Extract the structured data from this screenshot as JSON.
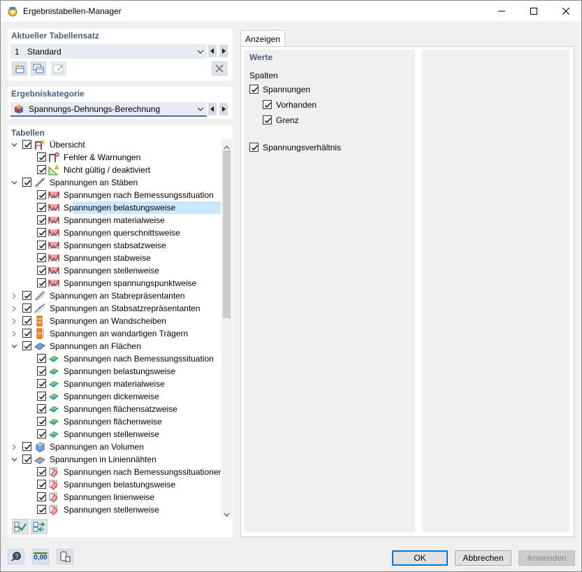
{
  "window": {
    "title": "Ergebnistabellen-Manager",
    "icon": "rfem-app-icon"
  },
  "tableset": {
    "section_title": "Aktueller Tabellensatz",
    "number": "1",
    "name": "Standard"
  },
  "category": {
    "section_title": "Ergebniskategorie",
    "value": "Spannungs-Dehnungs-Berechnung"
  },
  "tables": {
    "section_title": "Tabellen",
    "rows": [
      {
        "label": "Übersicht",
        "level": 0,
        "expander": "expanded",
        "checked": true,
        "icon": "overview-icon"
      },
      {
        "label": "Fehler & Warnungen",
        "level": 1,
        "checked": true,
        "icon": "error-warning-icon"
      },
      {
        "label": "Nicht gültig / deaktiviert",
        "level": 1,
        "checked": true,
        "icon": "invalid-icon"
      },
      {
        "label": "Spannungen an Stäben",
        "level": 0,
        "expander": "expanded",
        "checked": true,
        "icon": "member-icon"
      },
      {
        "label": "Spannungen nach Bemessungssituation",
        "level": 1,
        "checked": true,
        "icon": "stress-diagram-icon"
      },
      {
        "label": "Spannungen belastungsweise",
        "level": 1,
        "checked": true,
        "icon": "stress-diagram-icon",
        "selected": true
      },
      {
        "label": "Spannungen materialweise",
        "level": 1,
        "checked": true,
        "icon": "stress-diagram-icon"
      },
      {
        "label": "Spannungen querschnittsweise",
        "level": 1,
        "checked": true,
        "icon": "stress-diagram-icon"
      },
      {
        "label": "Spannungen stabsatzweise",
        "level": 1,
        "checked": true,
        "icon": "stress-diagram-icon"
      },
      {
        "label": "Spannungen stabweise",
        "level": 1,
        "checked": true,
        "icon": "stress-diagram-icon"
      },
      {
        "label": "Spannungen stellenweise",
        "level": 1,
        "checked": true,
        "icon": "stress-diagram-icon"
      },
      {
        "label": "Spannungen spannungspunktweise",
        "level": 1,
        "checked": true,
        "icon": "stress-diagram-icon"
      },
      {
        "label": "Spannungen an Stabrepräsentanten",
        "level": 0,
        "expander": "collapsed",
        "checked": true,
        "icon": "member-representative-icon"
      },
      {
        "label": "Spannungen an Stabsatzrepräsentanten",
        "level": 0,
        "expander": "collapsed",
        "checked": true,
        "icon": "memberset-representative-icon"
      },
      {
        "label": "Spannungen an Wandscheiben",
        "level": 0,
        "expander": "collapsed",
        "checked": true,
        "icon": "wall-icon"
      },
      {
        "label": "Spannungen an wandartigen Trägern",
        "level": 0,
        "expander": "collapsed",
        "checked": true,
        "icon": "deep-beam-icon"
      },
      {
        "label": "Spannungen an Flächen",
        "level": 0,
        "expander": "expanded",
        "checked": true,
        "icon": "surface-icon"
      },
      {
        "label": "Spannungen nach Bemessungssituation",
        "level": 1,
        "checked": true,
        "icon": "surface-stress-icon"
      },
      {
        "label": "Spannungen belastungsweise",
        "level": 1,
        "checked": true,
        "icon": "surface-stress-icon"
      },
      {
        "label": "Spannungen materialweise",
        "level": 1,
        "checked": true,
        "icon": "surface-stress-icon"
      },
      {
        "label": "Spannungen dickenweise",
        "level": 1,
        "checked": true,
        "icon": "surface-stress-icon"
      },
      {
        "label": "Spannungen flächensatzweise",
        "level": 1,
        "checked": true,
        "icon": "surface-stress-icon"
      },
      {
        "label": "Spannungen flächenweise",
        "level": 1,
        "checked": true,
        "icon": "surface-stress-icon"
      },
      {
        "label": "Spannungen stellenweise",
        "level": 1,
        "checked": true,
        "icon": "surface-stress-icon"
      },
      {
        "label": "Spannungen an Volumen",
        "level": 0,
        "expander": "collapsed",
        "checked": true,
        "icon": "solid-icon"
      },
      {
        "label": "Spannungen in Liniennähten",
        "level": 0,
        "expander": "expanded",
        "checked": true,
        "icon": "line-weld-icon"
      },
      {
        "label": "Spannungen nach Bemessungssituationen",
        "level": 1,
        "checked": true,
        "icon": "weld-stress-icon"
      },
      {
        "label": "Spannungen belastungsweise",
        "level": 1,
        "checked": true,
        "icon": "weld-stress-icon"
      },
      {
        "label": "Spannungen linienweise",
        "level": 1,
        "checked": true,
        "icon": "weld-stress-icon"
      },
      {
        "label": "Spannungen stellenweise",
        "level": 1,
        "checked": true,
        "icon": "weld-stress-icon"
      }
    ]
  },
  "display": {
    "tab_label": "Anzeigen",
    "values_title": "Werte",
    "columns_label": "Spalten",
    "options": [
      {
        "label": "Spannungen",
        "checked": true,
        "level": 0
      },
      {
        "label": "Vorhanden",
        "checked": true,
        "level": 1
      },
      {
        "label": "Grenz",
        "checked": true,
        "level": 1
      },
      {
        "label": "Spannungsverhältnis",
        "checked": true,
        "level": 0
      }
    ]
  },
  "footer": {
    "ok_label": "OK",
    "cancel_label": "Abbrechen",
    "apply_label": "Anwenden",
    "units_label": "0,00"
  },
  "colors": {
    "section_title": "#4a5e7a",
    "selection": "#cce8ff",
    "accent": "#0078d7"
  }
}
